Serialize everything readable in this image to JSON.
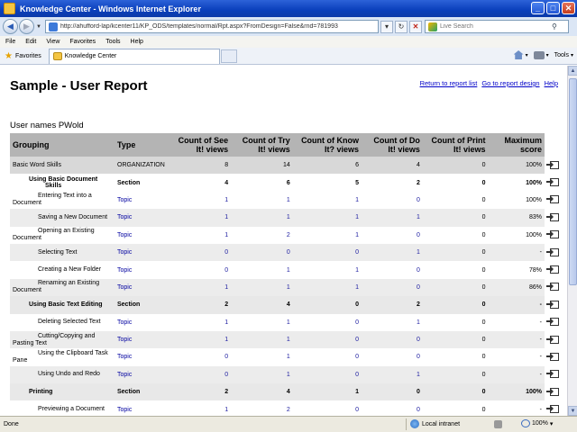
{
  "window": {
    "title": "Knowledge Center - Windows Internet Explorer",
    "minimize": "_",
    "maximize": "□",
    "close": "✕"
  },
  "address": {
    "url": "http://ahufford-lap/kcenter11/KP_ODS/templates/normal/Rpt.aspx?FromDesign=False&rnd=781993",
    "search_placeholder": "Live Search"
  },
  "menu": [
    "File",
    "Edit",
    "View",
    "Favorites",
    "Tools",
    "Help"
  ],
  "favorites": {
    "label": "Favorites",
    "tab_label": "Knowledge Center",
    "tools_label": "Tools"
  },
  "report": {
    "title": "Sample - User Report",
    "links": [
      "Return to report list",
      "Go to report design",
      "Help"
    ],
    "user_line": "User names PWold",
    "headers": [
      "Grouping",
      "Type",
      "Count of See It! views",
      "Count of Try It! views",
      "Count of Know It? views",
      "Count of Do It! views",
      "Count of Print It! views",
      "Maximum score"
    ],
    "rows": [
      {
        "kind": "org",
        "grouping": "Basic Word Skills",
        "type": "ORGANIZATION",
        "see": "8",
        "try": "14",
        "know": "6",
        "do": "4",
        "print": "0",
        "max": "100%"
      },
      {
        "kind": "section",
        "grouping": "Using Basic Document Skills",
        "type": "Section",
        "see": "4",
        "try": "6",
        "know": "5",
        "do": "2",
        "print": "0",
        "max": "100%"
      },
      {
        "kind": "topic",
        "grouping": "Entering Text into a Document",
        "type": "Topic",
        "see": "1",
        "try": "1",
        "know": "1",
        "do": "0",
        "print": "0",
        "max": "100%"
      },
      {
        "kind": "topic",
        "grouping": "Saving a New Document",
        "type": "Topic",
        "see": "1",
        "try": "1",
        "know": "1",
        "do": "1",
        "print": "0",
        "max": "83%"
      },
      {
        "kind": "topic",
        "grouping": "Opening an Existing Document",
        "type": "Topic",
        "see": "1",
        "try": "2",
        "know": "1",
        "do": "0",
        "print": "0",
        "max": "100%"
      },
      {
        "kind": "topic",
        "grouping": "Selecting Text",
        "type": "Topic",
        "see": "0",
        "try": "0",
        "know": "0",
        "do": "1",
        "print": "0",
        "max": "-"
      },
      {
        "kind": "topic",
        "grouping": "Creating a New Folder",
        "type": "Topic",
        "see": "0",
        "try": "1",
        "know": "1",
        "do": "0",
        "print": "0",
        "max": "78%"
      },
      {
        "kind": "topic",
        "grouping": "Renaming an Existing Document",
        "type": "Topic",
        "see": "1",
        "try": "1",
        "know": "1",
        "do": "0",
        "print": "0",
        "max": "86%"
      },
      {
        "kind": "section",
        "grouping": "Using Basic Text Editing",
        "type": "Section",
        "see": "2",
        "try": "4",
        "know": "0",
        "do": "2",
        "print": "0",
        "max": "-"
      },
      {
        "kind": "topic",
        "grouping": "Deleting Selected Text",
        "type": "Topic",
        "see": "1",
        "try": "1",
        "know": "0",
        "do": "1",
        "print": "0",
        "max": "-"
      },
      {
        "kind": "topic",
        "grouping": "Cutting/Copying and Pasting Text",
        "type": "Topic",
        "see": "1",
        "try": "1",
        "know": "0",
        "do": "0",
        "print": "0",
        "max": "-"
      },
      {
        "kind": "topic",
        "grouping": "Using the Clipboard Task Pane",
        "type": "Topic",
        "see": "0",
        "try": "1",
        "know": "0",
        "do": "0",
        "print": "0",
        "max": "-"
      },
      {
        "kind": "topic",
        "grouping": "Using Undo and Redo",
        "type": "Topic",
        "see": "0",
        "try": "1",
        "know": "0",
        "do": "1",
        "print": "0",
        "max": "-"
      },
      {
        "kind": "section",
        "grouping": "Printing",
        "type": "Section",
        "see": "2",
        "try": "4",
        "know": "1",
        "do": "0",
        "print": "0",
        "max": "100%"
      },
      {
        "kind": "topic",
        "grouping": "Previewing a Document",
        "type": "Topic",
        "see": "1",
        "try": "2",
        "know": "0",
        "do": "0",
        "print": "0",
        "max": "-"
      },
      {
        "kind": "topic",
        "grouping": "Using Web Page Preview",
        "type": "Topic",
        "see": "0",
        "try": "1",
        "know": "0",
        "do": "0",
        "print": "0",
        "max": "-"
      },
      {
        "kind": "topic",
        "grouping": "Printing the Current",
        "type": "Topic",
        "see": "1",
        "try": "1",
        "know": "1",
        "do": "0",
        "print": "0",
        "max": "100%"
      }
    ]
  },
  "status": {
    "left": "Done",
    "zone": "Local intranet",
    "zoom": "100%"
  },
  "icons": {
    "back": "back-arrow-icon",
    "forward": "forward-arrow-icon",
    "refresh": "refresh-icon",
    "stop": "stop-icon",
    "search": "search-icon",
    "favorites": "star-icon",
    "export": "export-icon"
  },
  "colors": {
    "titlebar": "#0a3fbb",
    "header_row": "#b4b4b4",
    "link": "#0000c8"
  }
}
